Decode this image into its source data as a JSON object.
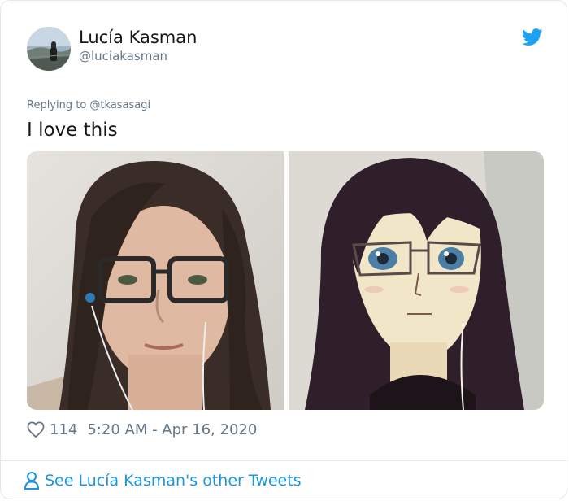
{
  "author": {
    "name": "Lucía Kasman",
    "handle": "@luciakasman"
  },
  "tweet": {
    "replying_to": "Replying to @tkasasagi",
    "text": "I love this"
  },
  "stats": {
    "likes": "114",
    "timestamp": "5:20 AM - Apr 16, 2020"
  },
  "footer": {
    "see_more": "See Lucía Kasman's other Tweets"
  },
  "icons": {
    "brand": "twitter-bird-icon",
    "like": "heart-icon",
    "profile": "person-icon"
  },
  "colors": {
    "accent": "#1b95e0",
    "twitter_blue": "#1da1f2",
    "muted_text": "#657786",
    "border": "#e1e8ed"
  }
}
